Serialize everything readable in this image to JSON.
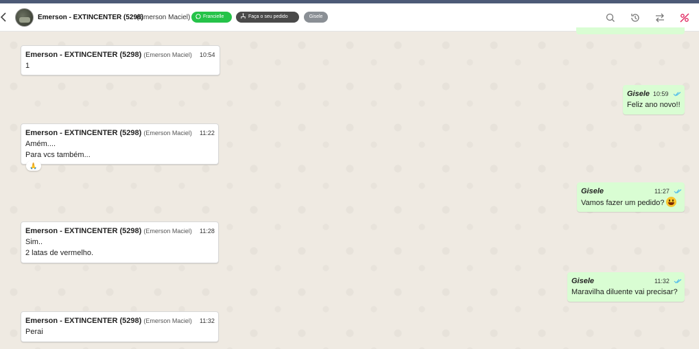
{
  "header": {
    "contact_name": "Emerson - EXTINCENTER (5298)",
    "contact_sub": "(Emerson Maciel)",
    "pills": {
      "connection": "Francielle",
      "queue": "Faça o seu pedido",
      "agent": "Gisele"
    },
    "icons": [
      "back-icon",
      "avatar",
      "whatsapp-icon",
      "queue-icon",
      "search-icon",
      "history-icon",
      "transfer-icon",
      "close-ticket-icon"
    ],
    "accent_colors": {
      "connection_pill": "#25c349",
      "queue_pill": "#4a4a4a",
      "agent_pill": "#8a8f95",
      "close_icon": "#e0245e",
      "outgoing_bubble": "#d9fdd3",
      "read_tick": "#53bdeb"
    }
  },
  "messages": [
    {
      "direction": "in",
      "sender": "Emerson - EXTINCENTER (5298)",
      "sender_sub": "(Emerson Maciel)",
      "time": "10:54",
      "lines": [
        "1"
      ]
    },
    {
      "direction": "out",
      "sender": "Gisele",
      "time": "10:59",
      "lines": [
        "Feliz ano novo!!"
      ],
      "status": "read"
    },
    {
      "direction": "in",
      "sender": "Emerson - EXTINCENTER (5298)",
      "sender_sub": "(Emerson Maciel)",
      "time": "11:22",
      "lines": [
        "Amém....",
        "Para vcs também..."
      ],
      "reaction": "🙏"
    },
    {
      "direction": "out",
      "sender": "Gisele",
      "time": "11:27",
      "lines": [
        "Vamos fazer um pedido?"
      ],
      "emoji": "grinning-face",
      "status": "read"
    },
    {
      "direction": "in",
      "sender": "Emerson - EXTINCENTER (5298)",
      "sender_sub": "(Emerson Maciel)",
      "time": "11:28",
      "lines": [
        "Sim..",
        "2 latas de vermelho."
      ]
    },
    {
      "direction": "out",
      "sender": "Gisele",
      "time": "11:32",
      "lines": [
        "Maravilha diluente vai precisar?"
      ],
      "status": "read"
    },
    {
      "direction": "in",
      "sender": "Emerson - EXTINCENTER (5298)",
      "sender_sub": "(Emerson Maciel)",
      "time": "11:32",
      "lines": [
        "Perai"
      ]
    }
  ]
}
